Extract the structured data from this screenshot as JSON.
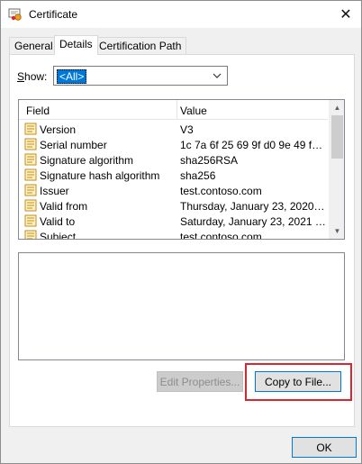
{
  "window": {
    "title": "Certificate",
    "close_glyph": "✕"
  },
  "tabs": [
    {
      "label": "General",
      "selected": false
    },
    {
      "label": "Details",
      "selected": true
    },
    {
      "label": "Certification Path",
      "selected": false
    }
  ],
  "show": {
    "label": "Show:",
    "value": "<All>"
  },
  "list": {
    "columns": [
      "Field",
      "Value"
    ],
    "rows": [
      {
        "field": "Version",
        "value": "V3"
      },
      {
        "field": "Serial number",
        "value": "1c 7a 6f 25 69 9f d0 9e 49 f5 ..."
      },
      {
        "field": "Signature algorithm",
        "value": "sha256RSA"
      },
      {
        "field": "Signature hash algorithm",
        "value": "sha256"
      },
      {
        "field": "Issuer",
        "value": "test.contoso.com"
      },
      {
        "field": "Valid from",
        "value": "Thursday, January 23, 2020 4..."
      },
      {
        "field": "Valid to",
        "value": "Saturday, January 23, 2021 5..."
      },
      {
        "field": "Subject",
        "value": "test.contoso.com"
      }
    ],
    "icon": "certificate-field-icon"
  },
  "buttons": {
    "edit_properties": "Edit Properties...",
    "copy_to_file": "Copy to File...",
    "ok": "OK"
  },
  "colors": {
    "highlight": "#d9262f",
    "selection": "#0078d7"
  }
}
